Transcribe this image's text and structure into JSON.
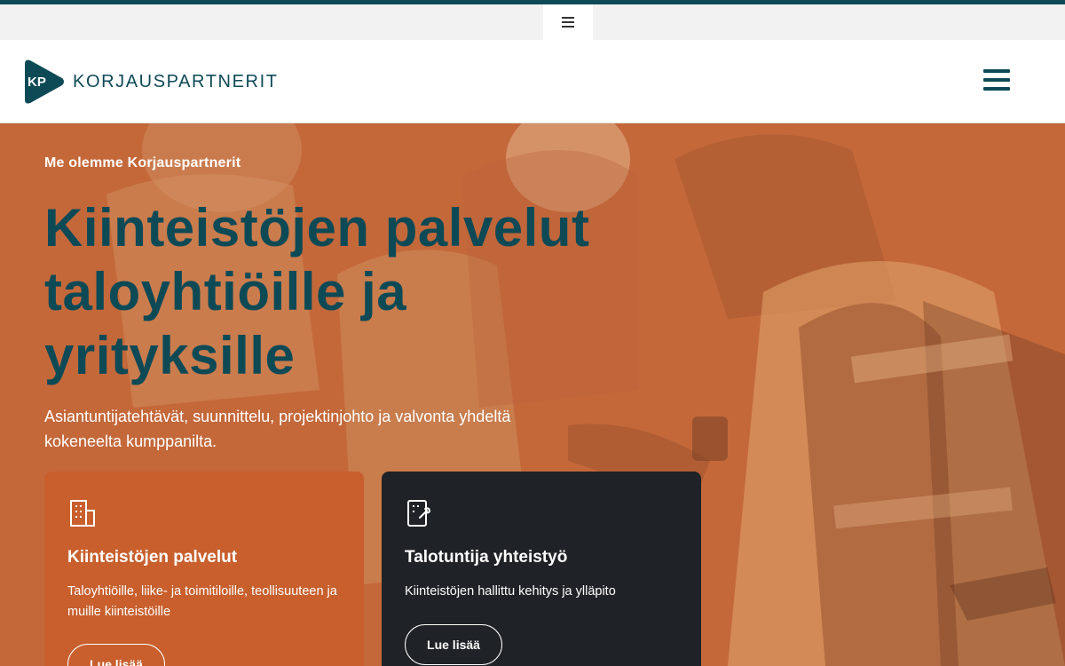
{
  "admin_bar": {
    "toggle_icon": "hamburger-icon"
  },
  "header": {
    "logo_mark_text": "KP",
    "logo_text": "KORJAUSPARTNERIT",
    "menu_icon": "hamburger-menu-icon",
    "brand_color": "#0e4a56"
  },
  "hero": {
    "eyebrow": "Me olemme Korjauspartnerit",
    "headline_lines": [
      "Kiinteistöjen palvelut",
      "taloyhtiöille ja",
      "yrityksille"
    ],
    "subtext": "Asiantuntijatehtävät, suunnittelu, projektinjohto ja valvonta yhdeltä kokeneelta kumppanilta.",
    "overlay_color": "#c4683a"
  },
  "cards": [
    {
      "icon": "building-icon",
      "title": "Kiinteistöjen palvelut",
      "text": "Taloyhtiöille, liike- ja toimitiloille, teollisuuteen ja muille kiinteistöille",
      "button": "Lue lisää",
      "color": "#c85f2d"
    },
    {
      "icon": "building-tools-icon",
      "title": "Talotuntija yhteistyö",
      "text": "Kiinteistöjen hallittu kehitys ja ylläpito",
      "button": "Lue lisää",
      "color": "#1f2226"
    }
  ]
}
